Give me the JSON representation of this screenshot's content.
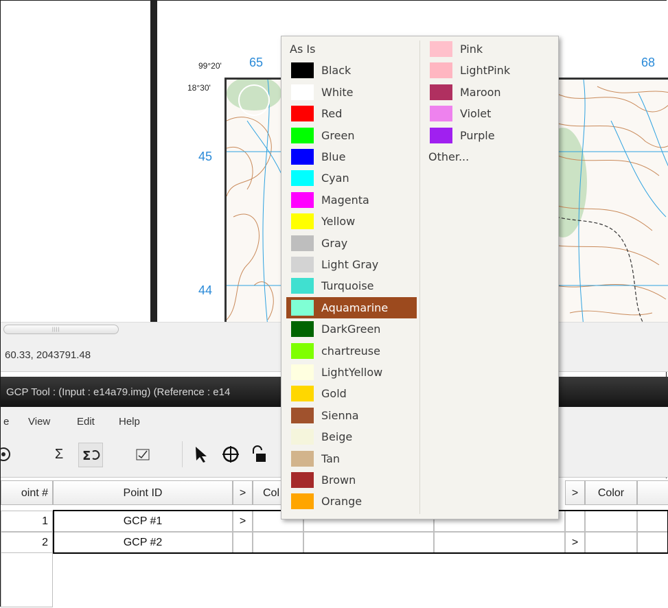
{
  "map": {
    "lon_label": "99°20'",
    "lat_label": "18°30'",
    "grid_top_left": "65",
    "grid_top_right": "68",
    "grid_left_upper": "45",
    "grid_left_lower": "44"
  },
  "status": {
    "coordinates": "60.33, 2043791.48"
  },
  "gcp_tool": {
    "title": "GCP Tool : (Input : e14a79.img) (Reference : e14"
  },
  "menubar": {
    "file_fragment": "e",
    "view": "View",
    "edit": "Edit",
    "help": "Help"
  },
  "toolbar": {
    "icons": [
      "crosshair-partial-icon",
      "sigma-icon",
      "sigma-auto-icon",
      "check-chart-icon",
      "select-arrow-icon",
      "target-icon",
      "lock-icon"
    ]
  },
  "table": {
    "headers": {
      "point_num": "oint #",
      "point_id": "Point ID",
      "arrow1": ">",
      "color1": "Col",
      "arrow2": ">",
      "color2": "Color"
    },
    "rows": [
      {
        "num": "1",
        "id": "GCP #1",
        "arrow1": ">",
        "arrow2": ""
      },
      {
        "num": "2",
        "id": "GCP #2",
        "arrow1": "",
        "arrow2": ">"
      }
    ]
  },
  "color_menu": {
    "left_column": [
      {
        "label": "As Is",
        "color": null
      },
      {
        "label": "Black",
        "color": "#000000"
      },
      {
        "label": "White",
        "color": "#ffffff"
      },
      {
        "label": "Red",
        "color": "#ff0000"
      },
      {
        "label": "Green",
        "color": "#00ff00"
      },
      {
        "label": "Blue",
        "color": "#0000ff"
      },
      {
        "label": "Cyan",
        "color": "#00ffff"
      },
      {
        "label": "Magenta",
        "color": "#ff00ff"
      },
      {
        "label": "Yellow",
        "color": "#ffff00"
      },
      {
        "label": "Gray",
        "color": "#bebebe"
      },
      {
        "label": "Light Gray",
        "color": "#d3d3d3"
      },
      {
        "label": "Turquoise",
        "color": "#40e0d0"
      },
      {
        "label": "Aquamarine",
        "color": "#7fffd4",
        "selected": true
      },
      {
        "label": "DarkGreen",
        "color": "#006400"
      },
      {
        "label": "chartreuse",
        "color": "#7fff00"
      },
      {
        "label": "LightYellow",
        "color": "#ffffe0"
      },
      {
        "label": "Gold",
        "color": "#ffd700"
      },
      {
        "label": "Sienna",
        "color": "#a0522d"
      },
      {
        "label": "Beige",
        "color": "#f5f5dc"
      },
      {
        "label": "Tan",
        "color": "#d2b48c"
      },
      {
        "label": "Brown",
        "color": "#a52a2a"
      },
      {
        "label": "Orange",
        "color": "#ffa500"
      }
    ],
    "right_column": [
      {
        "label": "Pink",
        "color": "#ffc0cb"
      },
      {
        "label": "LightPink",
        "color": "#ffb6c1"
      },
      {
        "label": "Maroon",
        "color": "#b03060"
      },
      {
        "label": "Violet",
        "color": "#ee82ee"
      },
      {
        "label": "Purple",
        "color": "#a020f0"
      },
      {
        "label": "Other...",
        "color": null
      }
    ],
    "selection_color": "#9c4a1e"
  }
}
